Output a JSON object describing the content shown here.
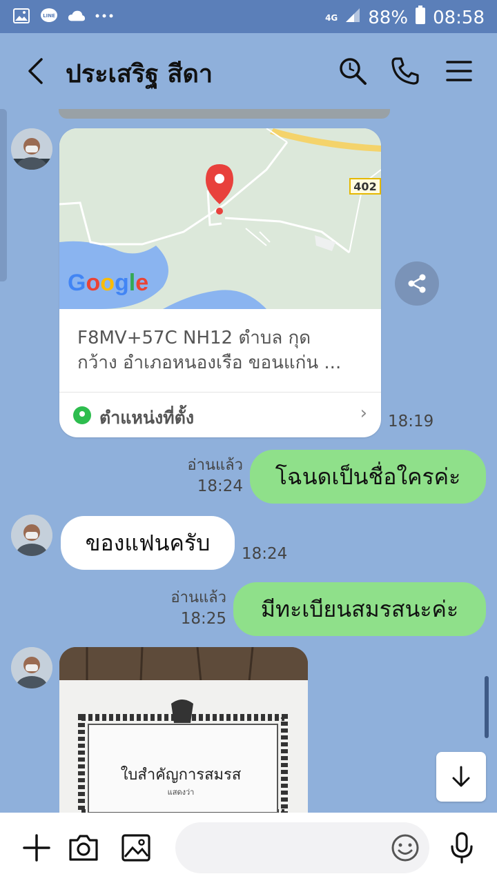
{
  "status_bar": {
    "network": "4G",
    "battery": "88%",
    "time": "08:58",
    "notification_icons": [
      "gallery-icon",
      "line-icon",
      "cloud-icon",
      "more-dots-icon"
    ]
  },
  "header": {
    "title": "ประเสริฐ  สีดา",
    "icons": [
      "back-arrow-icon",
      "search-icon",
      "phone-icon",
      "menu-icon"
    ]
  },
  "chat": {
    "location_card": {
      "map_label": "Google",
      "road_number": "402",
      "address_line1": "F8MV+57C NH12 ตำบล กุด",
      "address_line2": "กว้าง อำเภอหนองเรือ ขอนแก่น ...",
      "location_label": "ตำแหน่งที่ตั้ง",
      "time": "18:19"
    },
    "messages": [
      {
        "side": "out",
        "text": "โฉนดเป็นชื่อใครค่ะ",
        "read": "อ่านแล้ว",
        "time": "18:24"
      },
      {
        "side": "in",
        "text": "ของแฟนครับ",
        "time": "18:24"
      },
      {
        "side": "out",
        "text": "มีทะเบียนสมรสนะค่ะ",
        "read": "อ่านแล้ว",
        "time": "18:25"
      }
    ],
    "photo": {
      "caption": "ใบสำคัญการสมรส",
      "caption_sub": "แสดงว่า"
    }
  },
  "input_bar": {
    "placeholder": "",
    "icons": [
      "plus-icon",
      "camera-icon",
      "image-icon",
      "emoji-icon",
      "mic-icon"
    ]
  },
  "colors": {
    "background": "#8fb0db",
    "status_bar": "#5b7fb9",
    "outgoing_bubble": "#8fe08a",
    "incoming_bubble": "#ffffff",
    "location_pin": "#e8413c"
  }
}
